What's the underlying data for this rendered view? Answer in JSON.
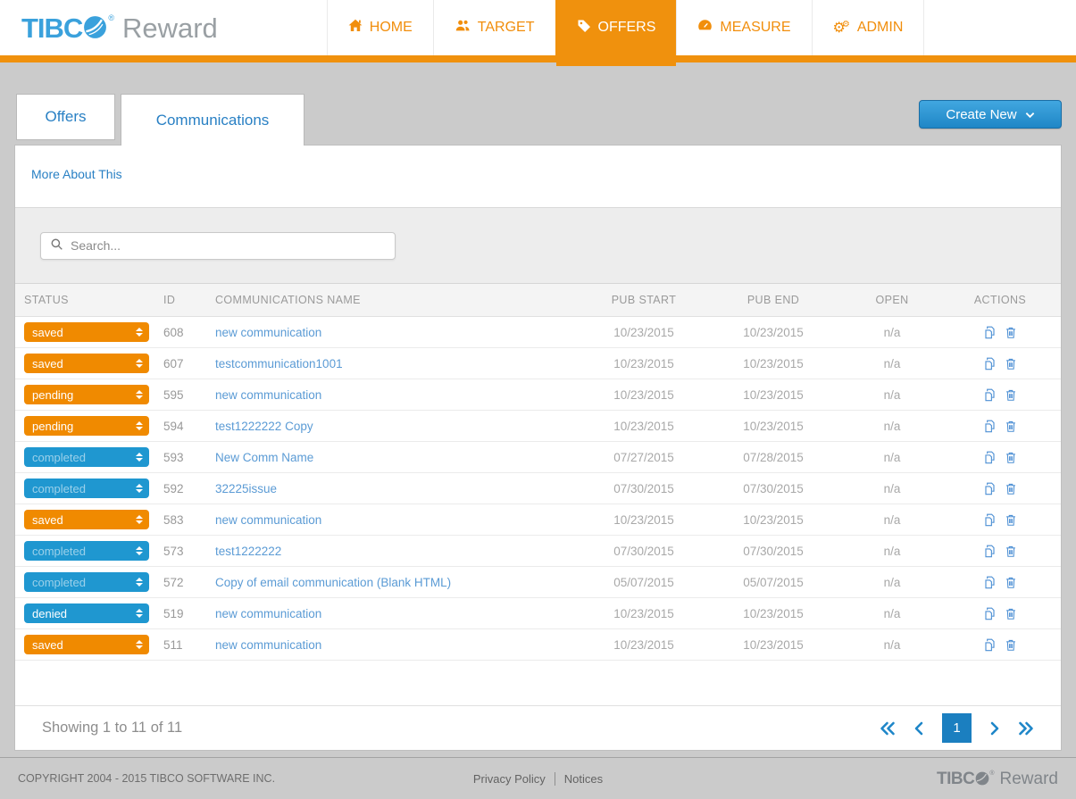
{
  "header": {
    "logo": {
      "tibco": "TIBC",
      "registered": "®",
      "reward": "Reward"
    },
    "nav": [
      {
        "label": "HOME",
        "icon": "home-icon",
        "active": false
      },
      {
        "label": "TARGET",
        "icon": "users-icon",
        "active": false
      },
      {
        "label": "OFFERS",
        "icon": "tag-icon",
        "active": true
      },
      {
        "label": "MEASURE",
        "icon": "gauge-icon",
        "active": false
      },
      {
        "label": "ADMIN",
        "icon": "gears-icon",
        "active": false
      }
    ]
  },
  "tabs": [
    {
      "label": "Offers",
      "active": false
    },
    {
      "label": "Communications",
      "active": true
    }
  ],
  "create_new": {
    "label": "Create New",
    "icon": "chevron-down-icon"
  },
  "more_about_label": "More About This",
  "search": {
    "placeholder": "Search...",
    "icon": "search-icon"
  },
  "table": {
    "headers": [
      "STATUS",
      "ID",
      "COMMUNICATIONS NAME",
      "PUB START",
      "PUB END",
      "OPEN",
      "ACTIONS"
    ],
    "rows": [
      {
        "status": "saved",
        "id": "608",
        "name": "new communication",
        "pub_start": "10/23/2015",
        "pub_end": "10/23/2015",
        "open": "n/a"
      },
      {
        "status": "saved",
        "id": "607",
        "name": "testcommunication1001",
        "pub_start": "10/23/2015",
        "pub_end": "10/23/2015",
        "open": "n/a"
      },
      {
        "status": "pending",
        "id": "595",
        "name": "new communication",
        "pub_start": "10/23/2015",
        "pub_end": "10/23/2015",
        "open": "n/a"
      },
      {
        "status": "pending",
        "id": "594",
        "name": "test1222222 Copy",
        "pub_start": "10/23/2015",
        "pub_end": "10/23/2015",
        "open": "n/a"
      },
      {
        "status": "completed",
        "id": "593",
        "name": "New Comm Name",
        "pub_start": "07/27/2015",
        "pub_end": "07/28/2015",
        "open": "n/a"
      },
      {
        "status": "completed",
        "id": "592",
        "name": "32225issue",
        "pub_start": "07/30/2015",
        "pub_end": "07/30/2015",
        "open": "n/a"
      },
      {
        "status": "saved",
        "id": "583",
        "name": "new communication",
        "pub_start": "10/23/2015",
        "pub_end": "10/23/2015",
        "open": "n/a"
      },
      {
        "status": "completed",
        "id": "573",
        "name": "test1222222",
        "pub_start": "07/30/2015",
        "pub_end": "07/30/2015",
        "open": "n/a"
      },
      {
        "status": "completed",
        "id": "572",
        "name": "Copy of email communication (Blank HTML)",
        "pub_start": "05/07/2015",
        "pub_end": "05/07/2015",
        "open": "n/a"
      },
      {
        "status": "denied",
        "id": "519",
        "name": "new communication",
        "pub_start": "10/23/2015",
        "pub_end": "10/23/2015",
        "open": "n/a"
      },
      {
        "status": "saved",
        "id": "511",
        "name": "new communication",
        "pub_start": "10/23/2015",
        "pub_end": "10/23/2015",
        "open": "n/a"
      }
    ],
    "row_action_icons": [
      "copy-icon",
      "trash-icon"
    ]
  },
  "status_variants": {
    "saved": "orange",
    "pending": "orange",
    "completed": "blue-muted",
    "denied": "blue"
  },
  "pagination": {
    "summary": "Showing 1 to 11 of 11",
    "current_page": "1",
    "icons": [
      "first-page-double-chevron-left",
      "prev-page-chevron-left",
      "next-page-chevron-right",
      "last-page-double-chevron-right"
    ]
  },
  "footer": {
    "copyright": "COPYRIGHT 2004 - 2015 TIBCO SOFTWARE INC.",
    "privacy_label": "Privacy Policy",
    "notices_label": "Notices",
    "logo": {
      "tibco": "TIBC",
      "registered": "®",
      "reward": "Reward"
    }
  },
  "colors": {
    "accent_orange": "#F0910D",
    "select_orange": "#F08A00",
    "select_blue": "#1F97D0",
    "button_blue_top": "#41A7E0",
    "button_blue_bottom": "#1F86C6",
    "link_blue": "#5B9BD5",
    "tab_text_blue": "#2980C4",
    "pager_blue": "#1B7FC0",
    "page_background": "#CBCBCB",
    "logo_blue": "#3AA1DC"
  }
}
